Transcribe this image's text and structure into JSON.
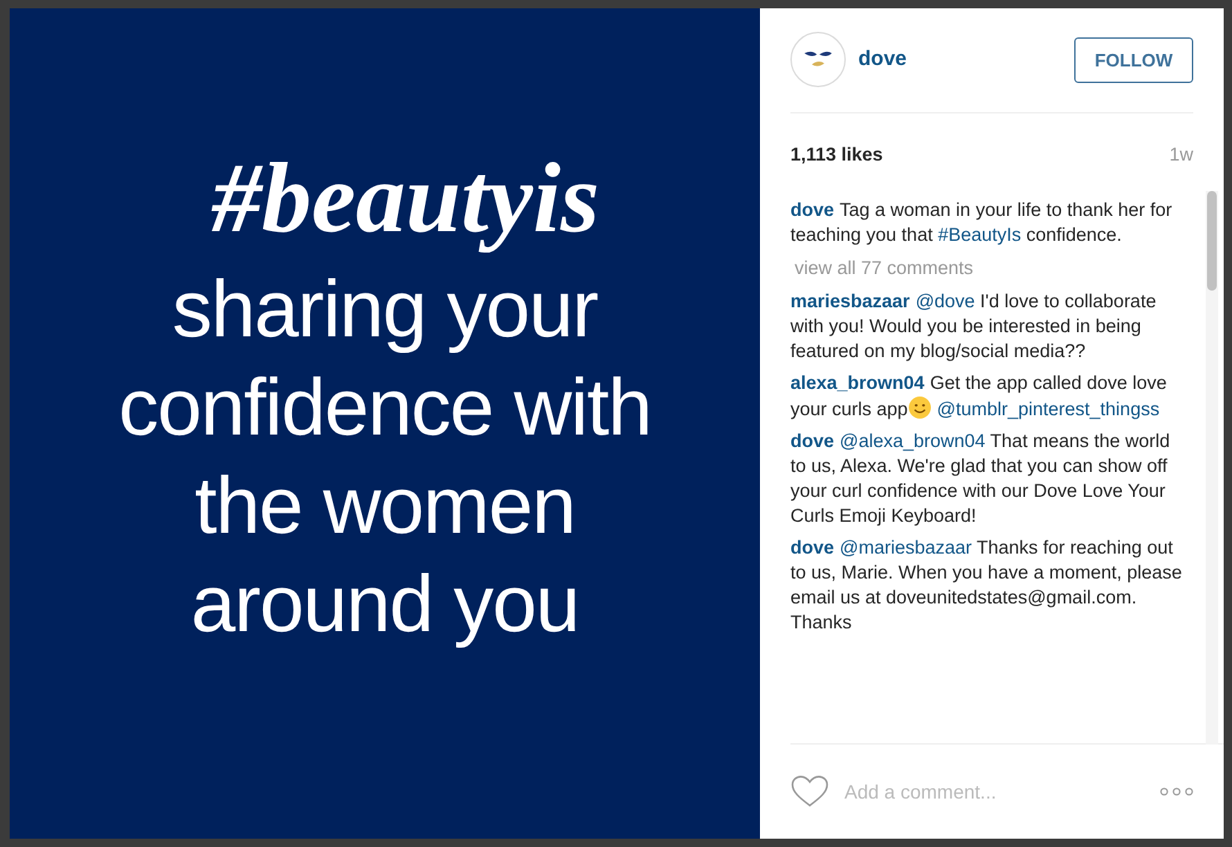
{
  "post_image": {
    "hashtag": "#beautyis",
    "lines": [
      "sharing your",
      "confidence with",
      "the women",
      "around you"
    ]
  },
  "header": {
    "username": "dove",
    "follow_button": "FOLLOW"
  },
  "likes": "1,113 likes",
  "age": "1w",
  "caption": {
    "parts": [
      {
        "kind": "user",
        "text": "dove"
      },
      {
        "kind": "plain",
        "text": "Tag a woman in your life to thank her for teaching you that "
      },
      {
        "kind": "link",
        "text": "#BeautyIs"
      },
      {
        "kind": "plain",
        "text": " confidence."
      }
    ]
  },
  "view_all": "view all 77 comments",
  "comments": [
    {
      "parts": [
        {
          "kind": "user",
          "text": "mariesbazaar"
        },
        {
          "kind": "link",
          "text": "@dove"
        },
        {
          "kind": "plain",
          "text": " I'd love to collaborate with you! Would you be interested in being featured on my blog/social media??"
        }
      ]
    },
    {
      "parts": [
        {
          "kind": "user",
          "text": "alexa_brown04"
        },
        {
          "kind": "plain",
          "text": "Get the app called dove love your curls app"
        },
        {
          "kind": "emoji"
        },
        {
          "kind": "link",
          "text": "@tumblr_pinterest_thingss"
        }
      ]
    },
    {
      "parts": [
        {
          "kind": "user",
          "text": "dove"
        },
        {
          "kind": "link",
          "text": "@alexa_brown04"
        },
        {
          "kind": "plain",
          "text": " That means the world to us, Alexa. We're glad that you can show off your curl confidence with our Dove Love Your Curls Emoji Keyboard!"
        }
      ]
    },
    {
      "parts": [
        {
          "kind": "user",
          "text": "dove"
        },
        {
          "kind": "link",
          "text": "@mariesbazaar"
        },
        {
          "kind": "plain",
          "text": " Thanks for reaching out to us, Marie. When you have a moment, please email us at doveunitedstates@gmail.com. Thanks"
        }
      ]
    }
  ],
  "comment_field": {
    "placeholder": "Add a comment..."
  }
}
